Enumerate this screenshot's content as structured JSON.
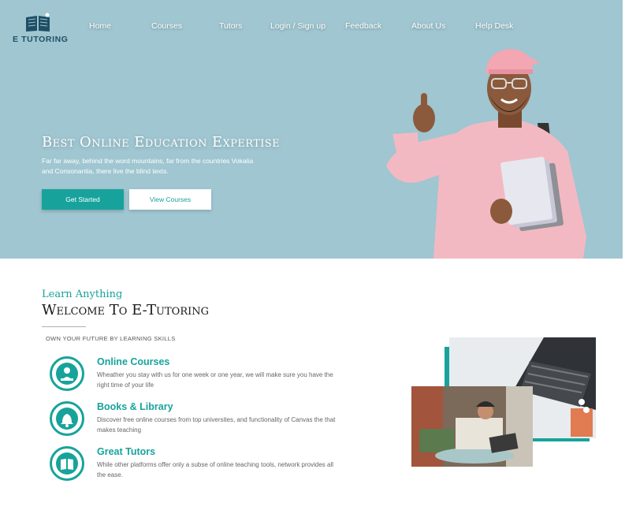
{
  "brand": {
    "name": "E TUTORING"
  },
  "nav": [
    {
      "label": "Home"
    },
    {
      "label": "Courses"
    },
    {
      "label": "Tutors"
    },
    {
      "label": "Login / Sign up"
    },
    {
      "label": "Feedback"
    },
    {
      "label": "About Us"
    },
    {
      "label": "Help Desk"
    }
  ],
  "hero": {
    "title": "Best Online Education Expertise",
    "description": "Far far away, behind the word mountains, far from the countries Vokalia and Consonantia, there live the blind texts.",
    "primary_button": "Get Started",
    "secondary_button": "View Courses"
  },
  "welcome": {
    "kicker": "Learn Anything",
    "title": "Welcome To E-Tutoring",
    "tagline": "OWN YOUR FUTURE BY LEARNING SKILLS"
  },
  "features": [
    {
      "title": "Online Courses",
      "text": "Wheather you stay with us for one week or one year, we will make sure you have the right time of your life",
      "icon": "online-course-icon"
    },
    {
      "title": "Books & Library",
      "text": "Discover free online courses from top universites, and functionality of Canvas the that makes teaching",
      "icon": "bell-icon"
    },
    {
      "title": "Great Tutors",
      "text": "While other platforms offer only a subse of online teaching tools, network provides all the ease.",
      "icon": "book-icon"
    }
  ],
  "colors": {
    "accent": "#17a39b",
    "hero_bg": "#9fc6d1",
    "heading": "#1a1a1a"
  }
}
